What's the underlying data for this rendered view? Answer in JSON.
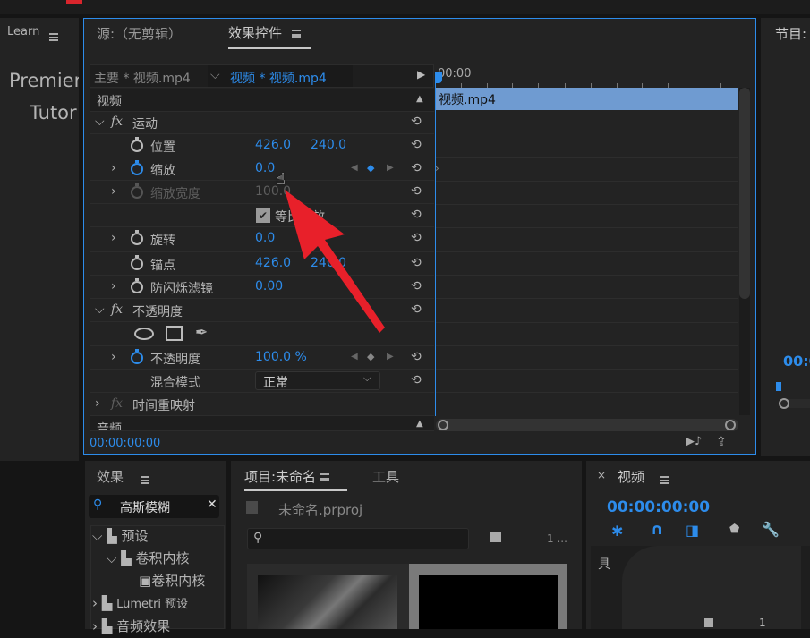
{
  "left_panel": {
    "tab": "Learn",
    "title_line1": "Premier",
    "title_line2": "Tutor"
  },
  "source_tab": "源:（无剪辑）",
  "effect_controls": {
    "tab": "效果控件",
    "clip_master": "主要 * 视频.mp4",
    "clip_active": "视频 * 视频.mp4",
    "timeline_time": "00:00",
    "clip_bar": "视频.mp4",
    "section_video": "视频",
    "motion": {
      "label": "运动",
      "fx": "fx"
    },
    "position": {
      "label": "位置",
      "x": "426.0",
      "y": "240.0"
    },
    "scale": {
      "label": "缩放",
      "value": "0.0"
    },
    "scale_width": {
      "label": "缩放宽度",
      "value": "100.0"
    },
    "uniform_scale": {
      "label": "等比缩放",
      "checked": true
    },
    "rotation": {
      "label": "旋转",
      "value": "0.0"
    },
    "anchor": {
      "label": "锚点",
      "x": "426.0",
      "y": "240.0"
    },
    "anti_flicker": {
      "label": "防闪烁滤镜",
      "value": "0.00"
    },
    "opacity_group": {
      "label": "不透明度",
      "fx": "fx"
    },
    "opacity": {
      "label": "不透明度",
      "value": "100.0 %"
    },
    "blend_mode": {
      "label": "混合模式",
      "value": "正常"
    },
    "time_remap": {
      "label": "时间重映射",
      "fx": "fx"
    },
    "section_audio": "音频",
    "timecode": "00:00:00:00"
  },
  "program": {
    "tab": "节目:",
    "timecode": "00:0"
  },
  "effects_panel": {
    "tab": "效果",
    "search": "高斯模糊",
    "tree": [
      "预设",
      "卷积内核",
      "卷积内核",
      "Lumetri 预设",
      "音频效果"
    ]
  },
  "project_panel": {
    "tab": "项目:未命名",
    "tab2": "工具",
    "file": "未命名.prproj",
    "count": "1 ..."
  },
  "timeline_panel": {
    "tab": "视频",
    "timecode": "00:00:00:00",
    "partial": "具",
    "count": "1"
  },
  "colors": {
    "accent": "#2d8ceb",
    "clip": "#6f9bd1",
    "arrow": "#e8202a"
  }
}
